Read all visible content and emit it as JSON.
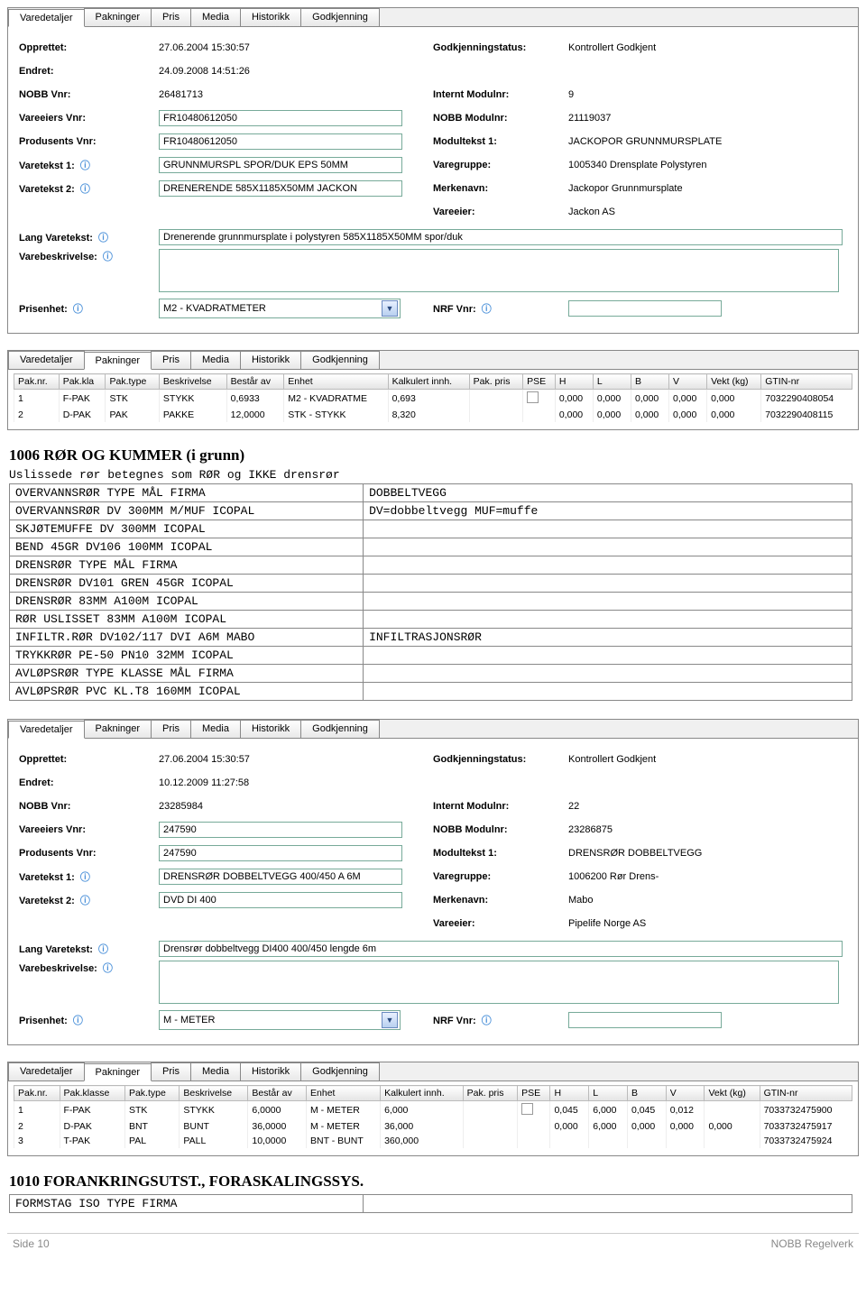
{
  "tabs": {
    "varedetaljer": "Varedetaljer",
    "pakninger": "Pakninger",
    "pris": "Pris",
    "media": "Media",
    "historikk": "Historikk",
    "godkjenning": "Godkjenning"
  },
  "labels": {
    "opprettet": "Opprettet:",
    "endret": "Endret:",
    "nobb_vnr": "NOBB Vnr:",
    "vareeiers_vnr": "Vareeiers Vnr:",
    "produsents_vnr": "Produsents Vnr:",
    "varetekst1": "Varetekst 1:",
    "varetekst2": "Varetekst 2:",
    "godkj_status": "Godkjenningstatus:",
    "internt_modulnr": "Internt Modulnr:",
    "nobb_modulnr": "NOBB Modulnr:",
    "modultekst1": "Modultekst 1:",
    "varegruppe": "Varegruppe:",
    "merkenavn": "Merkenavn:",
    "vareeier": "Vareeier:",
    "lang_varetekst": "Lang Varetekst:",
    "varebeskrivelse": "Varebeskrivelse:",
    "prisenhet": "Prisenhet:",
    "nrf_vnr": "NRF Vnr:"
  },
  "panel1": {
    "opprettet": "27.06.2004 15:30:57",
    "endret": "24.09.2008 14:51:26",
    "nobb_vnr": "26481713",
    "vareeiers_vnr": "FR10480612050",
    "produsents_vnr": "FR10480612050",
    "varetekst1": "GRUNNMURSPL SPOR/DUK EPS 50MM",
    "varetekst2": "DRENERENDE 585X1185X50MM JACKON",
    "godkj_status": "Kontrollert Godkjent",
    "internt_modulnr": "9",
    "nobb_modulnr": "21119037",
    "modultekst1": "JACKOPOR GRUNNMURSPLATE",
    "varegruppe": "1005340 Drensplate Polystyren",
    "merkenavn": "Jackopor Grunnmursplate",
    "vareeier": "Jackon AS",
    "lang_varetekst": "Drenerende grunnmursplate i polystyren 585X1185X50MM spor/duk",
    "prisenhet": "M2 - KVADRATMETER",
    "nrf_vnr": ""
  },
  "pak1": {
    "head": {
      "nr": "Pak.nr.",
      "kla": "Pak.kla",
      "type": "Pak.type",
      "beskr": "Beskrivelse",
      "bestar": "Består av",
      "enhet": "Enhet",
      "kalk": "Kalkulert innh.",
      "pris": "Pak. pris",
      "pse": "PSE",
      "h": "H",
      "l": "L",
      "b": "B",
      "v": "V",
      "vekt": "Vekt (kg)",
      "gtin": "GTIN-nr"
    },
    "rows": [
      {
        "nr": "1",
        "kla": "F-PAK",
        "type": "STK",
        "beskr": "STYKK",
        "bestar": "0,6933",
        "enhet": "M2 - KVADRATME",
        "kalk": "0,693",
        "pris": "",
        "pse": true,
        "h": "0,000",
        "l": "0,000",
        "b": "0,000",
        "v": "0,000",
        "vekt": "0,000",
        "gtin": "7032290408054"
      },
      {
        "nr": "2",
        "kla": "D-PAK",
        "type": "PAK",
        "beskr": "PAKKE",
        "bestar": "12,0000",
        "enhet": "STK - STYKK",
        "kalk": "8,320",
        "pris": "",
        "pse": false,
        "h": "0,000",
        "l": "0,000",
        "b": "0,000",
        "v": "0,000",
        "vekt": "0,000",
        "gtin": "7032290408115"
      }
    ]
  },
  "section1": {
    "title": "1006 RØR OG KUMMER (i grunn)",
    "subtitle": "Uslissede rør betegnes som RØR og IKKE drensrør",
    "rows": [
      [
        "OVERVANNSRØR TYPE MÅL   FIRMA",
        "DOBBELTVEGG"
      ],
      [
        "OVERVANNSRØR DV 300MM M/MUF ICOPAL",
        "DV=dobbeltvegg  MUF=muffe"
      ],
      [
        "SKJØTEMUFFE DV 300MM ICOPAL",
        ""
      ],
      [
        "BEND 45GR DV106 100MM ICOPAL",
        ""
      ],
      [
        "DRENSRØR TYPE MÅL FIRMA",
        ""
      ],
      [
        "DRENSRØR DV101 GREN 45GR ICOPAL",
        ""
      ],
      [
        "DRENSRØR 83MM A100M ICOPAL",
        ""
      ],
      [
        "RØR USLISSET 83MM A100M ICOPAL",
        ""
      ],
      [
        "INFILTR.RØR DV102/117 DVI A6M MABO",
        "INFILTRASJONSRØR"
      ],
      [
        "TRYKKRØR PE-50 PN10 32MM ICOPAL",
        ""
      ],
      [
        "AVLØPSRØR TYPE KLASSE MÅL FIRMA",
        ""
      ],
      [
        "AVLØPSRØR PVC KL.T8 160MM ICOPAL",
        ""
      ]
    ]
  },
  "panel2": {
    "opprettet": "27.06.2004 15:30:57",
    "endret": "10.12.2009 11:27:58",
    "nobb_vnr": "23285984",
    "vareeiers_vnr": "247590",
    "produsents_vnr": "247590",
    "varetekst1": "DRENSRØR DOBBELTVEGG 400/450 A 6M",
    "varetekst2": "DVD DI 400",
    "godkj_status": "Kontrollert Godkjent",
    "internt_modulnr": "22",
    "nobb_modulnr": "23286875",
    "modultekst1": "DRENSRØR DOBBELTVEGG",
    "varegruppe": "1006200 Rør Drens-",
    "merkenavn": "Mabo",
    "vareeier": "Pipelife Norge  AS",
    "lang_varetekst": "Drensrør dobbeltvegg DI400 400/450 lengde 6m ",
    "prisenhet": "M - METER",
    "nrf_vnr": ""
  },
  "pak2": {
    "head": {
      "nr": "Pak.nr.",
      "kla": "Pak.klasse",
      "type": "Pak.type",
      "beskr": "Beskrivelse",
      "bestar": "Består av",
      "enhet": "Enhet",
      "kalk": "Kalkulert innh.",
      "pris": "Pak. pris",
      "pse": "PSE",
      "h": "H",
      "l": "L",
      "b": "B",
      "v": "V",
      "vekt": "Vekt (kg)",
      "gtin": "GTIN-nr"
    },
    "rows": [
      {
        "nr": "1",
        "kla": "F-PAK",
        "type": "STK",
        "beskr": "STYKK",
        "bestar": "6,0000",
        "enhet": "M - METER",
        "kalk": "6,000",
        "pris": "",
        "pse": true,
        "h": "0,045",
        "l": "6,000",
        "b": "0,045",
        "v": "0,012",
        "vekt": "",
        "gtin": "7033732475900"
      },
      {
        "nr": "2",
        "kla": "D-PAK",
        "type": "BNT",
        "beskr": "BUNT",
        "bestar": "36,0000",
        "enhet": "M - METER",
        "kalk": "36,000",
        "pris": "",
        "pse": false,
        "h": "0,000",
        "l": "6,000",
        "b": "0,000",
        "v": "0,000",
        "vekt": "0,000",
        "gtin": "7033732475917"
      },
      {
        "nr": "3",
        "kla": "T-PAK",
        "type": "PAL",
        "beskr": "PALL",
        "bestar": "10,0000",
        "enhet": "BNT - BUNT",
        "kalk": "360,000",
        "pris": "",
        "pse": false,
        "h": "",
        "l": "",
        "b": "",
        "v": "",
        "vekt": "",
        "gtin": "7033732475924"
      }
    ]
  },
  "section2": {
    "title": "1010 FORANKRINGSUTST., FORASKALINGSSYS.",
    "rows": [
      [
        "FORMSTAG ISO TYPE FIRMA",
        ""
      ]
    ]
  },
  "footer": {
    "left": "Side 10",
    "right": "NOBB Regelverk"
  }
}
